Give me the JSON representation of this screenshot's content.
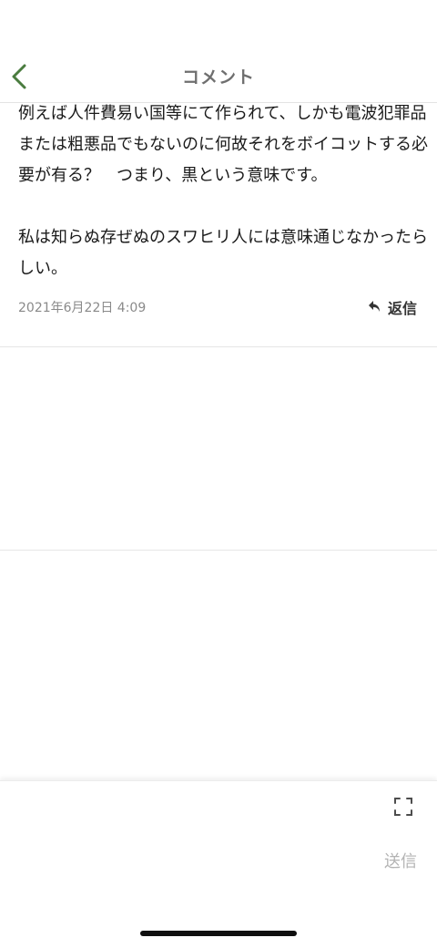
{
  "header": {
    "title": "コメント",
    "back_icon": "chevron-left-icon",
    "accent_color": "#4a7c3f"
  },
  "comment": {
    "paragraphs": [
      "例えば人件費易い国等にて作られて、しかも電波犯罪品または粗悪品でもないのに何故それをボイコットする必要が有る？　つまり、黒という意味です。",
      "私は知らぬ存ぜぬのスワヒリ人には意味通じなかったらしい。"
    ],
    "timestamp": "2021年6月22日 4:09",
    "reply_icon": "reply-arrow-icon",
    "reply_label": "返信"
  },
  "composer": {
    "expand_icon": "expand-icon",
    "input_value": "",
    "send_label": "送信"
  }
}
